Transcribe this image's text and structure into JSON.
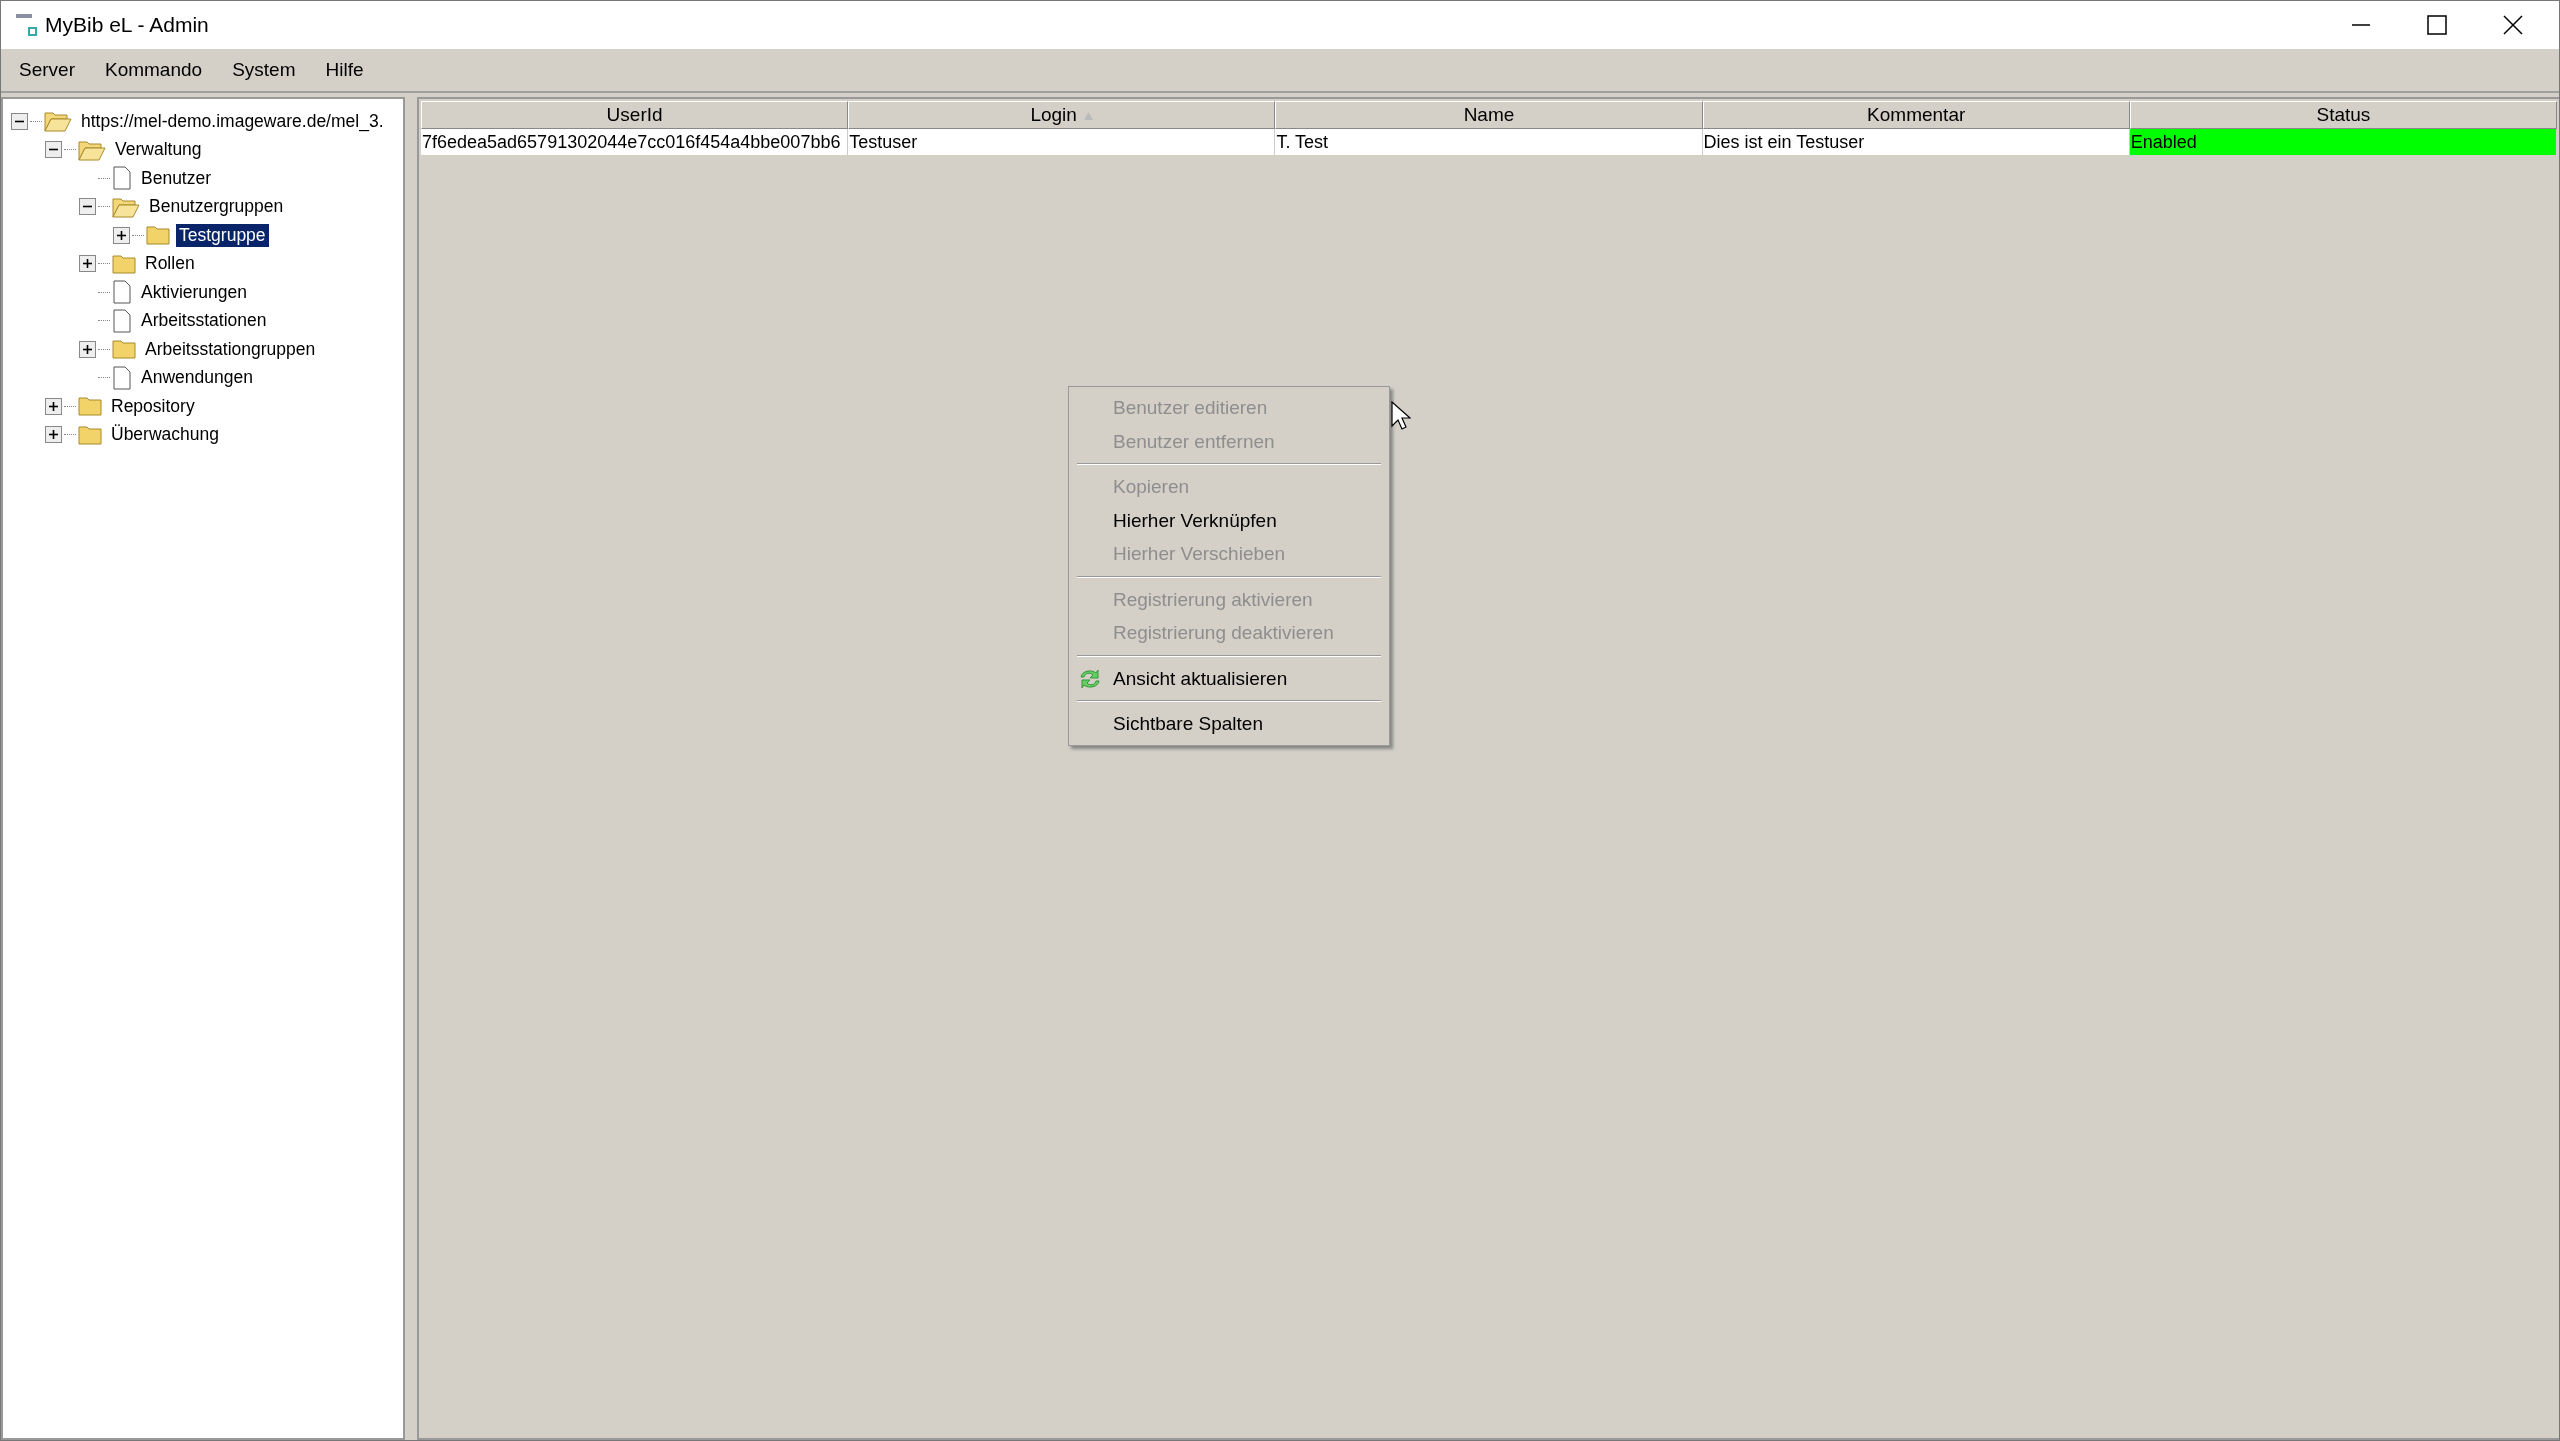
{
  "window": {
    "title": "MyBib eL - Admin"
  },
  "menu": [
    "Server",
    "Kommando",
    "System",
    "Hilfe"
  ],
  "tree": [
    {
      "label": "https://mel-demo.imageware.de/mel_3.",
      "kind": "folder",
      "expanded": true,
      "selected": false,
      "children": [
        {
          "label": "Verwaltung",
          "kind": "folder",
          "expanded": true,
          "selected": false,
          "children": [
            {
              "label": "Benutzer",
              "kind": "file",
              "selected": false
            },
            {
              "label": "Benutzergruppen",
              "kind": "folder",
              "expanded": true,
              "selected": false,
              "children": [
                {
                  "label": "Testgruppe",
                  "kind": "folder",
                  "expanded": false,
                  "selected": true
                }
              ]
            },
            {
              "label": "Rollen",
              "kind": "folder",
              "expanded": false,
              "selected": false
            },
            {
              "label": "Aktivierungen",
              "kind": "file",
              "selected": false
            },
            {
              "label": "Arbeitsstationen",
              "kind": "file",
              "selected": false
            },
            {
              "label": "Arbeitsstationgruppen",
              "kind": "folder",
              "expanded": false,
              "selected": false
            },
            {
              "label": "Anwendungen",
              "kind": "file",
              "selected": false
            }
          ]
        },
        {
          "label": "Repository",
          "kind": "folder",
          "expanded": false,
          "selected": false
        },
        {
          "label": "Überwachung",
          "kind": "folder",
          "expanded": false,
          "selected": false
        }
      ]
    }
  ],
  "table": {
    "columns": [
      {
        "label": "UserId",
        "sorted": false
      },
      {
        "label": "Login",
        "sorted": true
      },
      {
        "label": "Name",
        "sorted": false
      },
      {
        "label": "Kommentar",
        "sorted": false
      },
      {
        "label": "Status",
        "sorted": false
      }
    ],
    "rows": [
      {
        "cells": [
          "7f6edea5ad65791302044e7cc016f454a4bbe007bb6",
          "Testuser",
          "T. Test",
          "Dies ist ein Testuser"
        ],
        "status": {
          "label": "Enabled",
          "color": "#00ff00"
        }
      }
    ]
  },
  "context_menu": {
    "groups": [
      [
        {
          "label": "Benutzer editieren",
          "disabled": true
        },
        {
          "label": "Benutzer entfernen",
          "disabled": true
        }
      ],
      [
        {
          "label": "Kopieren",
          "disabled": true
        },
        {
          "label": "Hierher Verknüpfen",
          "disabled": false
        },
        {
          "label": "Hierher Verschieben",
          "disabled": true
        }
      ],
      [
        {
          "label": "Registrierung aktivieren",
          "disabled": true
        },
        {
          "label": "Registrierung deaktivieren",
          "disabled": true
        }
      ],
      [
        {
          "label": "Ansicht aktualisieren",
          "disabled": false,
          "kind": "refresh"
        }
      ],
      [
        {
          "label": "Sichtbare Spalten",
          "disabled": false
        }
      ]
    ]
  }
}
